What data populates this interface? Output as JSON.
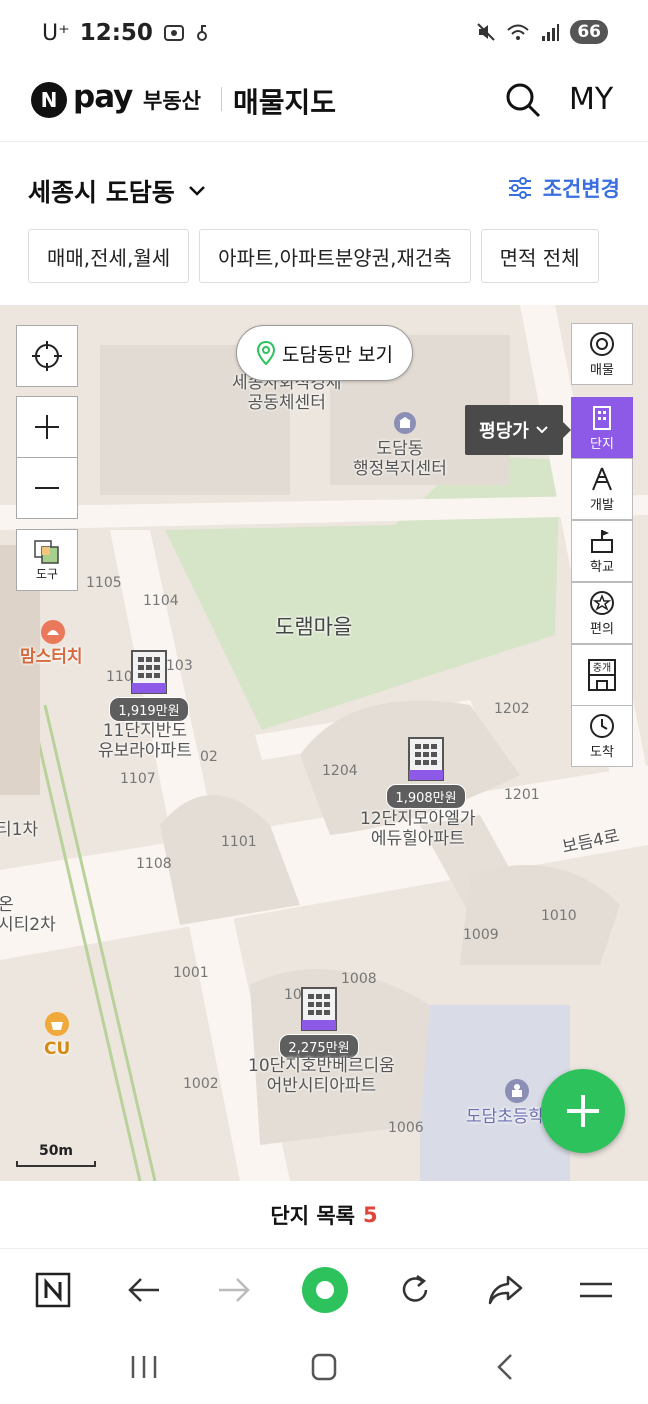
{
  "status_bar": {
    "carrier": "U⁺",
    "time": "12:50",
    "battery": "66"
  },
  "header": {
    "logo_n": "N",
    "logo_pay": "pay",
    "logo_service": "부동산",
    "page_title": "매물지도",
    "my_label": "MY"
  },
  "location": {
    "title": "세종시 도담동",
    "condition_label": "조건변경"
  },
  "filters": [
    "매매,전세,월세",
    "아파트,아파트분양권,재건축",
    "면적 전체"
  ],
  "map": {
    "dong_only_button": "도담동만 보기",
    "tool_label": "도구",
    "price_type_label": "평당가",
    "right_tools": [
      "매물",
      "단지",
      "개발",
      "학교",
      "편의",
      "도착"
    ],
    "broker_icon_text": "중개",
    "scale_label": "50m",
    "area_labels": [
      "도램마을"
    ],
    "poi": [
      {
        "name": "세종사회적경제\n공동체센터"
      },
      {
        "name": "도담동\n행정복지센터"
      },
      {
        "name": "맘스터치"
      },
      {
        "name": "CU"
      },
      {
        "name": "도담초등학"
      },
      {
        "name": "보듬4로"
      },
      {
        "name": "온\n시티2차"
      },
      {
        "name": "티1차"
      }
    ],
    "building_numbers": [
      "1105",
      "1104",
      "110",
      "103",
      "1107",
      "02",
      "1108",
      "1101",
      "1202",
      "1204",
      "1201",
      "1010",
      "1009",
      "1001",
      "1008",
      "1002",
      "100",
      "1006"
    ],
    "complexes": [
      {
        "price": "1,919만원",
        "name": "11단지반도\n유보라아파트"
      },
      {
        "price": "1,908만원",
        "name": "12단지모아엘가\n에듀힐아파트"
      },
      {
        "price": "2,275만원",
        "name": "10단지호반베르디움\n어반시티아파트"
      }
    ]
  },
  "list_bar": {
    "label": "단지 목록",
    "count": "5"
  },
  "browser_bar": {
    "n_label": "N"
  },
  "colors": {
    "accent_purple": "#8c5ae6",
    "accent_blue": "#3a6fe0",
    "fab_green": "#2ec25c",
    "count_red": "#e0443a"
  }
}
